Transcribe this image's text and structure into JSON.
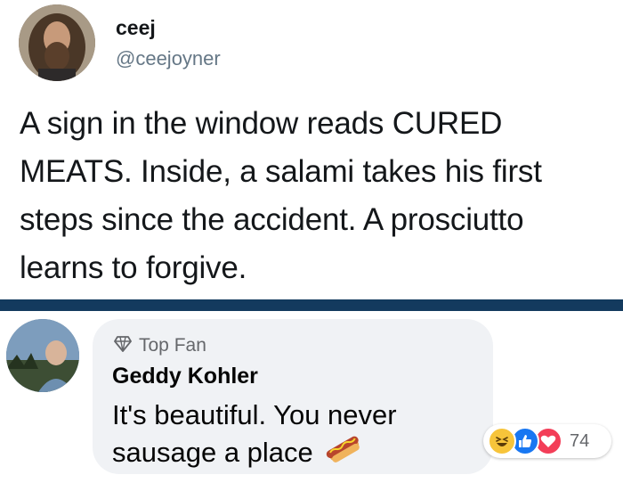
{
  "tweet": {
    "author_name": "ceej",
    "author_handle": "@ceejoyner",
    "text": "A sign in the window reads CURED MEATS. Inside, a salami takes his first steps since the accident. A prosciutto learns to forgive."
  },
  "comment": {
    "badge_label": "Top Fan",
    "author_name": "Geddy Kohler",
    "text": "It's beautiful. You never sausage a place",
    "emoji": "hotdog-icon",
    "reactions": {
      "icons": [
        "haha-icon",
        "like-icon",
        "love-icon"
      ],
      "count": "74"
    }
  },
  "colors": {
    "divider": "#133a5e",
    "bubble": "#f0f2f5",
    "like": "#1877f2",
    "love": "#f33e58",
    "haha": "#f7c43a"
  }
}
